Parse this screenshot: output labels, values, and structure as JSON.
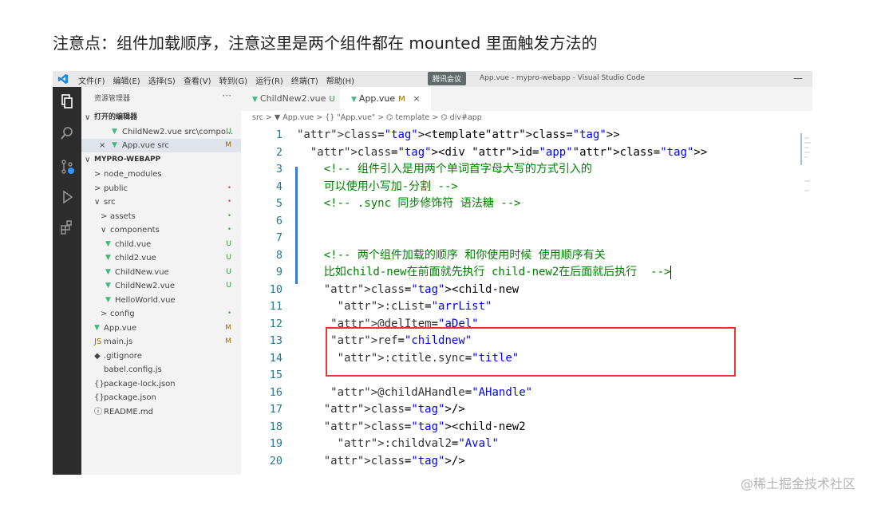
{
  "heading": "注意点：组件加载顺序，注意这里是两个组件都在 mounted 里面触发方法的",
  "titlebar": {
    "menu": [
      "文件(F)",
      "编辑(E)",
      "选择(S)",
      "查看(V)",
      "转到(G)",
      "运行(R)",
      "终端(T)",
      "帮助(H)"
    ],
    "meeting_badge": "腾讯会议",
    "window_title": "App.vue - mypro-webapp - Visual Studio Code",
    "minimize": "—"
  },
  "sidebar": {
    "header": "资源管理器",
    "more": "···",
    "open_editors_title": "打开的编辑器",
    "open_editors": [
      {
        "name": "ChildNew2.vue",
        "path": "src\\compo...",
        "status": "U"
      },
      {
        "name": "App.vue",
        "path": "src",
        "status": "M"
      }
    ],
    "project_title": "MYPRO-WEBAPP",
    "tree": [
      {
        "label": "node_modules",
        "prefix": ">",
        "status": ""
      },
      {
        "label": "public",
        "prefix": ">",
        "status": "•"
      },
      {
        "label": "src",
        "prefix": "∨",
        "status": "•"
      },
      {
        "label": "assets",
        "prefix": ">",
        "status": "•"
      },
      {
        "label": "components",
        "prefix": "∨",
        "status": "•"
      },
      {
        "label": "child.vue",
        "prefix": "",
        "status": "U"
      },
      {
        "label": "child2.vue",
        "prefix": "",
        "status": "U"
      },
      {
        "label": "ChildNew.vue",
        "prefix": "",
        "status": "U"
      },
      {
        "label": "ChildNew2.vue",
        "prefix": "",
        "status": "U"
      },
      {
        "label": "HelloWorld.vue",
        "prefix": "",
        "status": ""
      },
      {
        "label": "config",
        "prefix": ">",
        "status": "•"
      },
      {
        "label": "App.vue",
        "prefix": "",
        "status": "M"
      },
      {
        "label": "main.js",
        "prefix": "JS",
        "status": "M"
      },
      {
        "label": ".gitignore",
        "prefix": "◆",
        "status": ""
      },
      {
        "label": "babel.config.js",
        "prefix": "",
        "status": ""
      },
      {
        "label": "package-lock.json",
        "prefix": "{}",
        "status": ""
      },
      {
        "label": "package.json",
        "prefix": "{}",
        "status": ""
      },
      {
        "label": "README.md",
        "prefix": "ⓘ",
        "status": ""
      }
    ]
  },
  "tabs": [
    {
      "label": "ChildNew2.vue",
      "flag": "U"
    },
    {
      "label": "App.vue",
      "flag": "M",
      "close": "×"
    }
  ],
  "breadcrumb": "src > ▼ App.vue > {} \"App.vue\" > ⌬ template > ⌬ div#app",
  "code_lines": [
    {
      "n": "1",
      "html": "<template>"
    },
    {
      "n": "2",
      "html": "  <div id=\"app\">"
    },
    {
      "n": "3",
      "html": "    <!-- 组件引入是用两个单词首字母大写的方式引入的"
    },
    {
      "n": "4",
      "html": "    可以使用小写加-分割 -->"
    },
    {
      "n": "5",
      "html": "    <!-- .sync 同步修饰符 语法糖 -->"
    },
    {
      "n": "6",
      "html": ""
    },
    {
      "n": "7",
      "html": ""
    },
    {
      "n": "8",
      "html": "    <!-- 两个组件加载的顺序 和你使用时候 使用顺序有关"
    },
    {
      "n": "9",
      "html": "    比如child-new在前面就先执行 child-new2在后面就后执行  -->"
    },
    {
      "n": "10",
      "html": "    <child-new"
    },
    {
      "n": "11",
      "html": "      :cList=\"arrList\""
    },
    {
      "n": "12",
      "html": "     @delItem=\"aDel\""
    },
    {
      "n": "13",
      "html": "     ref=\"childnew\""
    },
    {
      "n": "14",
      "html": "      :ctitle.sync=\"title\""
    },
    {
      "n": "15",
      "html": ""
    },
    {
      "n": "16",
      "html": "     @childAHandle=\"AHandle\""
    },
    {
      "n": "17",
      "html": "    />"
    },
    {
      "n": "18",
      "html": "    <child-new2"
    },
    {
      "n": "19",
      "html": "      :childval2=\"Aval\""
    },
    {
      "n": "20",
      "html": "    />"
    }
  ],
  "watermark": "@稀土掘金技术社区"
}
